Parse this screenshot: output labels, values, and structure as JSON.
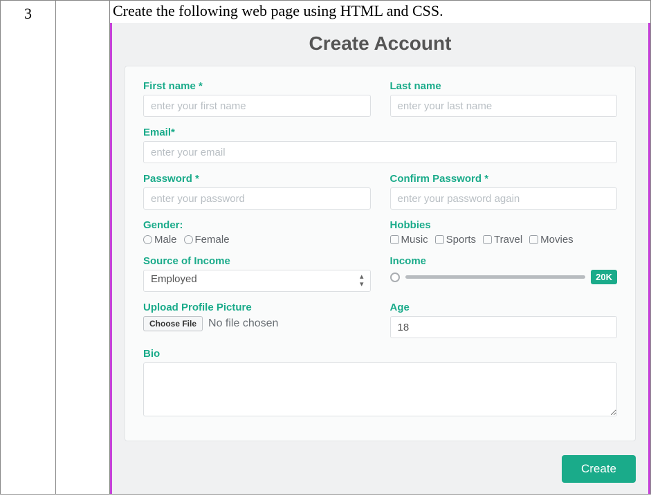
{
  "doc": {
    "row_number": "3",
    "instruction": "Create the following web page using HTML and CSS."
  },
  "form": {
    "title": "Create Account",
    "first_name": {
      "label": "First name *",
      "placeholder": "enter your first name"
    },
    "last_name": {
      "label": "Last name",
      "placeholder": "enter your last name"
    },
    "email": {
      "label": "Email*",
      "placeholder": "enter your email"
    },
    "password": {
      "label": "Password *",
      "placeholder": "enter your password"
    },
    "confirm_password": {
      "label": "Confirm Password *",
      "placeholder": "enter your password again"
    },
    "gender": {
      "label": "Gender:",
      "options": [
        "Male",
        "Female"
      ]
    },
    "hobbies": {
      "label": "Hobbies",
      "options": [
        "Music",
        "Sports",
        "Travel",
        "Movies"
      ]
    },
    "income_source": {
      "label": "Source of Income",
      "value": "Employed"
    },
    "income": {
      "label": "Income",
      "badge": "20K"
    },
    "upload": {
      "label": "Upload Profile Picture",
      "button": "Choose File",
      "status": "No file chosen"
    },
    "age": {
      "label": "Age",
      "value": "18"
    },
    "bio": {
      "label": "Bio"
    },
    "submit": "Create"
  }
}
